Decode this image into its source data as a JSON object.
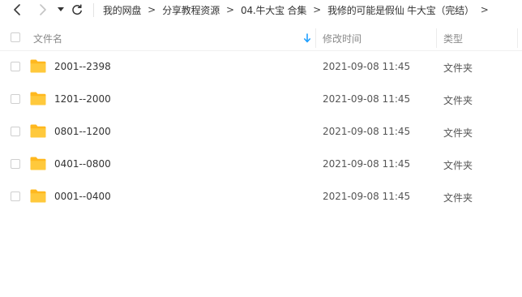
{
  "navigation": {
    "back_icon": "chevron-left-icon",
    "forward_icon": "chevron-right-icon",
    "dropdown_icon": "caret-down-icon",
    "refresh_icon": "refresh-icon",
    "breadcrumb": [
      "我的网盘",
      "分享教程资源",
      "04.牛大宝 合集",
      "我修的可能是假仙 牛大宝（完结）"
    ],
    "separator": ">"
  },
  "table": {
    "headers": {
      "name": "文件名",
      "modified": "修改时间",
      "type": "类型"
    },
    "sort_icon": "sort-down-arrow-icon",
    "rows": [
      {
        "name": "2001--2398",
        "modified": "2021-09-08 11:45",
        "type": "文件夹",
        "icon": "folder-icon"
      },
      {
        "name": "1201--2000",
        "modified": "2021-09-08 11:45",
        "type": "文件夹",
        "icon": "folder-icon"
      },
      {
        "name": "0801--1200",
        "modified": "2021-09-08 11:45",
        "type": "文件夹",
        "icon": "folder-icon"
      },
      {
        "name": "0401--0800",
        "modified": "2021-09-08 11:45",
        "type": "文件夹",
        "icon": "folder-icon"
      },
      {
        "name": "0001--0400",
        "modified": "2021-09-08 11:45",
        "type": "文件夹",
        "icon": "folder-icon"
      }
    ]
  },
  "colors": {
    "folder": "#ffc93c",
    "folder_tab": "#ffb81f",
    "sort_arrow": "#1e9fff",
    "text_primary": "#333333",
    "text_secondary": "#8a8a8a"
  }
}
